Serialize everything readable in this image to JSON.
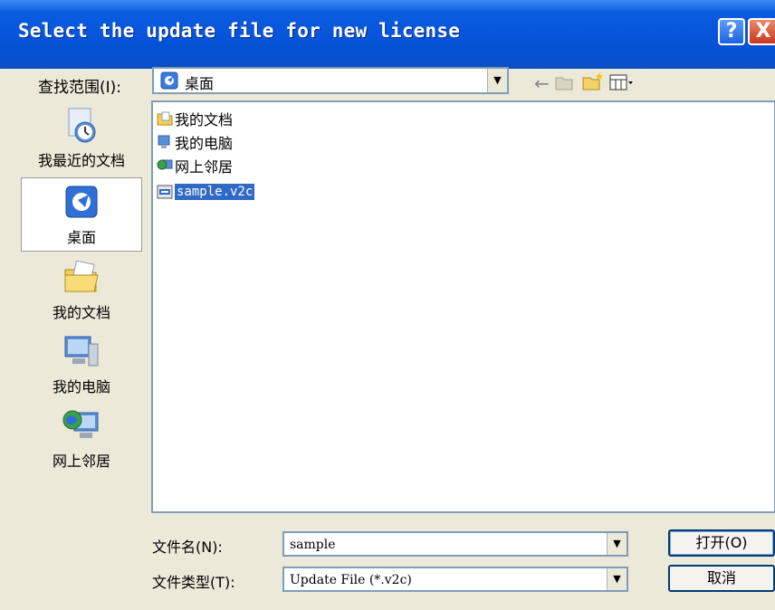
{
  "dialog": {
    "title": "Select the update file for new license",
    "help_glyph": "?",
    "close_glyph": "X"
  },
  "look_in": {
    "label": "查找范围(I):",
    "value": "桌面",
    "icon": "desktop-icon"
  },
  "toolbar": {
    "back_glyph": "←",
    "up_icon": "up-folder-icon",
    "new_folder_icon": "new-folder-icon",
    "views_icon": "views-menu-icon"
  },
  "places": [
    {
      "label": "我最近的文档",
      "icon": "recent-documents-icon"
    },
    {
      "label": "桌面",
      "icon": "desktop-icon"
    },
    {
      "label": "我的文档",
      "icon": "my-documents-icon"
    },
    {
      "label": "我的电脑",
      "icon": "my-computer-icon"
    },
    {
      "label": "网上邻居",
      "icon": "network-places-icon"
    }
  ],
  "files": [
    {
      "name": "我的文档",
      "icon": "folder-icon"
    },
    {
      "name": "我的电脑",
      "icon": "computer-icon"
    },
    {
      "name": "网上邻居",
      "icon": "network-icon"
    },
    {
      "name": "sample.v2c",
      "icon": "v2c-file-icon",
      "selected": true
    }
  ],
  "file_name": {
    "label": "文件名(N):",
    "value": "sample"
  },
  "file_type": {
    "label": "文件类型(T):",
    "value": "Update File (*.v2c)"
  },
  "buttons": {
    "open": "打开(O)",
    "cancel": "取消"
  },
  "colors": {
    "title_bar": "#0553d9",
    "selection": "#316ac5",
    "dialog_bg": "#ece9d8"
  }
}
